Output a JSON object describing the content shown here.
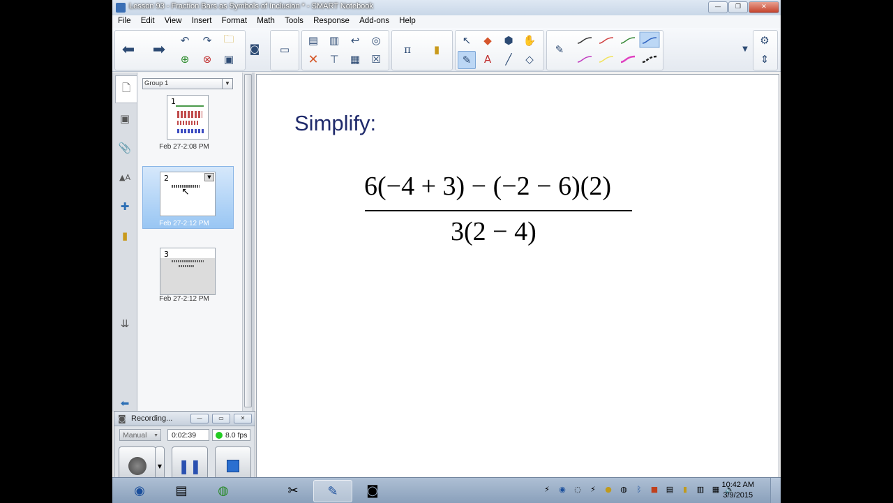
{
  "window": {
    "title": "Lesson 93 - Fraction Bars as Symbols of Inclusion * - SMART Notebook",
    "controls": [
      "minimize",
      "maximize",
      "close"
    ]
  },
  "menu": [
    "File",
    "Edit",
    "View",
    "Insert",
    "Format",
    "Math",
    "Tools",
    "Response",
    "Add-ons",
    "Help"
  ],
  "toolbar": {
    "icons": [
      "back-arrow-icon",
      "forward-arrow-icon",
      "undo-icon",
      "redo-icon",
      "open-file-icon",
      "save-icon",
      "add-page-icon",
      "delete-page-icon",
      "document-camera-icon",
      "screen-shade-icon",
      "screen-capture-icon",
      "full-screen-icon",
      "undo-arrow-icon",
      "table-icon",
      "delete-icon",
      "pi-math-icon",
      "response-icon",
      "select-icon",
      "shapes-icon",
      "eraser-icon",
      "magic-pen-icon",
      "pen-icon",
      "text-icon",
      "line-icon",
      "fill-icon"
    ],
    "pen_colors": [
      "#333333",
      "#d04040",
      "#3a8a3a",
      "#2b5fbf",
      "#c03cc0",
      "#f2e35a",
      "#e040c0",
      "#222222"
    ]
  },
  "sorter": {
    "group_label": "Group 1",
    "pages": [
      {
        "num": "1",
        "date": "Feb 27-2:08 PM"
      },
      {
        "num": "2",
        "date": "Feb 27-2:12 PM"
      },
      {
        "num": "3",
        "date": "Feb 27-2:12 PM"
      }
    ]
  },
  "canvas": {
    "heading": "Simplify:",
    "numerator": "6(−4 + 3) − (−2 − 6)(2)",
    "denominator": "3(2 − 4)"
  },
  "recorder": {
    "title": "Recording...",
    "mode": "Manual",
    "time": "0:02:39",
    "fps": "8.0 fps",
    "status_color": "#22cc22"
  },
  "taskbar": {
    "time": "10:42 AM",
    "date": "3/9/2015"
  }
}
